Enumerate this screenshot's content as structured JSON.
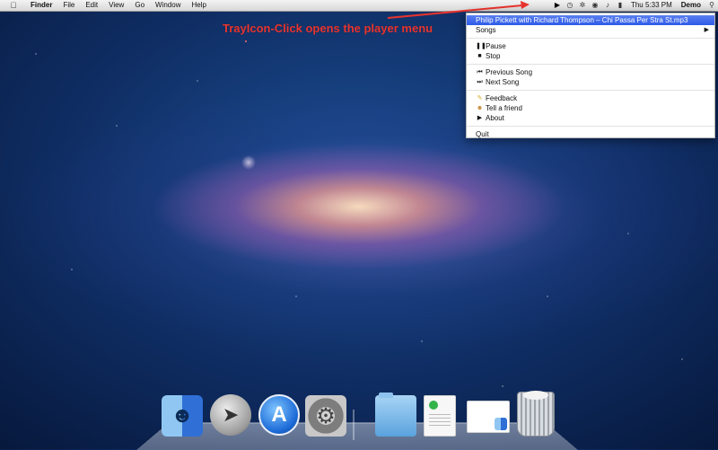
{
  "menubar": {
    "apple_icon": "apple-icon",
    "app_name": "Finder",
    "menus": [
      "File",
      "Edit",
      "View",
      "Go",
      "Window",
      "Help"
    ],
    "clock": "Thu 5:33 PM",
    "user": "Demo",
    "tray_icons": [
      "play-icon",
      "time-machine-icon",
      "bluetooth-icon",
      "wifi-icon",
      "volume-icon",
      "battery-icon",
      "spotlight-icon"
    ]
  },
  "annotation": {
    "text": "TrayIcon-Click opens the player menu",
    "color": "#e8342e"
  },
  "player_menu": {
    "now_playing": "Philip Pickett with Richard Thompson – Chi Passa Per Stra St.mp3",
    "songs": "Songs",
    "pause": "Pause",
    "stop": "Stop",
    "previous_song": "Previous Song",
    "next_song": "Next Song",
    "feedback": "Feedback",
    "tell_a_friend": "Tell a friend",
    "about": "About",
    "quit": "Quit",
    "highlight_color": "#2e5be8"
  },
  "dock": {
    "apps": [
      "finder-icon",
      "launchpad-icon",
      "app-store-icon",
      "system-preferences-icon",
      "folder-icon",
      "document-icon",
      "preview-icon",
      "trash-icon"
    ]
  }
}
